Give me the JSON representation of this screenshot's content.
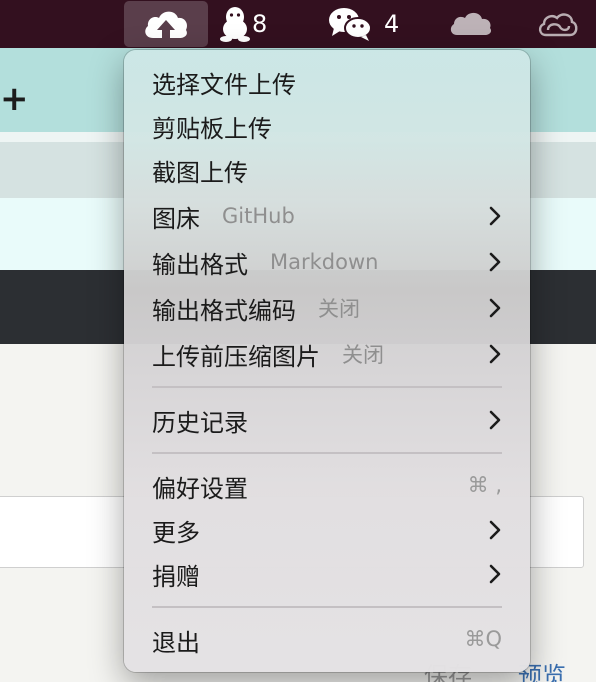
{
  "menubar": {
    "cloud_upload_icon": "cloud-upload-icon",
    "qq_count": "8",
    "wechat_count": "4"
  },
  "background_app": {
    "add_symbol": "+",
    "link_left": "保存",
    "link_right": "预览"
  },
  "menu": {
    "items": [
      {
        "label": "选择文件上传"
      },
      {
        "label": "剪贴板上传"
      },
      {
        "label": "截图上传"
      },
      {
        "label": "图床",
        "value": "GitHub"
      },
      {
        "label": "输出格式",
        "value": "Markdown"
      },
      {
        "label": "输出格式编码",
        "value": "关闭"
      },
      {
        "label": "上传前压缩图片",
        "value": "关闭"
      },
      {
        "label": "历史记录"
      },
      {
        "label": "偏好设置",
        "shortcut": "⌘ ,"
      },
      {
        "label": "更多"
      },
      {
        "label": "捐赠"
      },
      {
        "label": "退出",
        "shortcut": "⌘Q"
      }
    ]
  },
  "colors": {
    "menubar_bg": "#33101f",
    "menu_text": "#1b1b1b",
    "menu_value": "#8f8f8f",
    "teal_band": "#b3dfdc"
  }
}
